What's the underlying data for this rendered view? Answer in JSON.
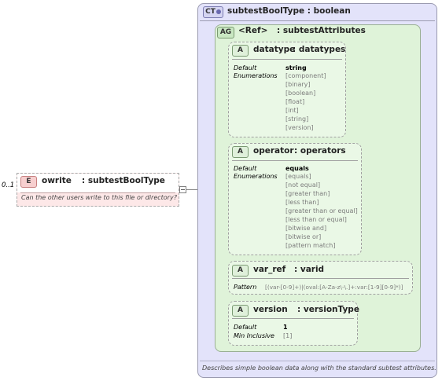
{
  "element": {
    "occurrence": "0..1",
    "badge": "E",
    "name": "owrite",
    "type": ": subtestBoolType",
    "documentation": "Can the other users write to this file or directory?"
  },
  "complex_type": {
    "badge": "CT",
    "title": "subtestBoolType : boolean",
    "documentation": "Describes simple boolean data along with the standard subtest attributes."
  },
  "attribute_group": {
    "badge": "AG",
    "name": "<Ref>",
    "type": ": subtestAttributes"
  },
  "attributes": [
    {
      "badge": "A",
      "name": "datatype",
      "type": ": datatypes",
      "default_label": "Default",
      "default_value": "string",
      "enum_label": "Enumerations",
      "enumerations": [
        "[component]",
        "[binary]",
        "[boolean]",
        "[float]",
        "[int]",
        "[string]",
        "[version]"
      ]
    },
    {
      "badge": "A",
      "name": "operator",
      "type": ": operators",
      "default_label": "Default",
      "default_value": "equals",
      "enum_label": "Enumerations",
      "enumerations": [
        "[equals]",
        "[not equal]",
        "[greater than]",
        "[less than]",
        "[greater than or equal]",
        "[less than or equal]",
        "[bitwise and]",
        "[bitwise or]",
        "[pattern match]"
      ]
    },
    {
      "badge": "A",
      "name": "var_ref",
      "type": ": varid",
      "pattern_label": "Pattern",
      "pattern_value": "[(var-[0-9]+)|(oval:[A-Za-z\\-\\.]+:var:[1-9][0-9]*)]"
    },
    {
      "badge": "A",
      "name": "version",
      "type": ": versionType",
      "default_label": "Default",
      "default_value": "1",
      "min_label": "Min Inclusive",
      "min_value": "[1]"
    }
  ]
}
